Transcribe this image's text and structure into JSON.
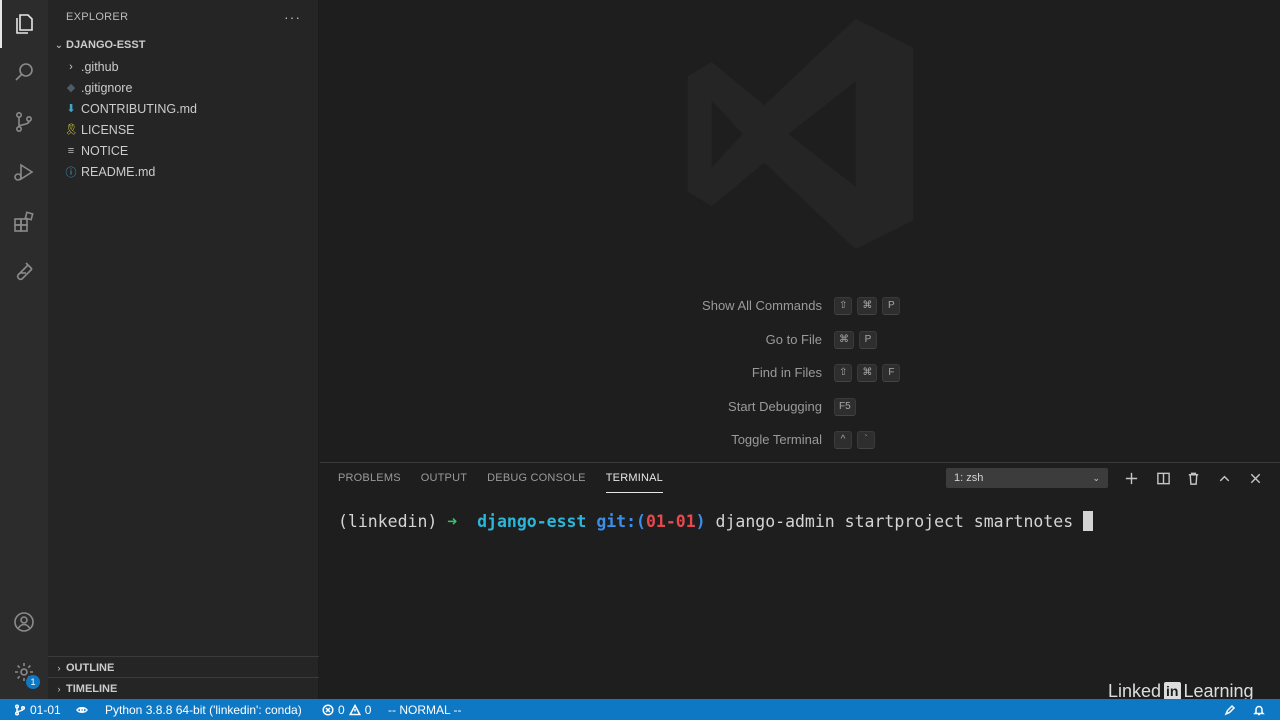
{
  "sidebar": {
    "title": "EXPLORER",
    "more": "···",
    "root": "DJANGO-ESST",
    "items": [
      {
        "label": ".github",
        "icon": "chevron-right-icon",
        "glyph": "›",
        "color": "#cccccc"
      },
      {
        "label": ".gitignore",
        "icon": "git-diamond-icon",
        "glyph": "◆",
        "color": "#4f5b66"
      },
      {
        "label": "CONTRIBUTING.md",
        "icon": "markdown-icon",
        "glyph": "⬇",
        "color": "#42a5c5"
      },
      {
        "label": "LICENSE",
        "icon": "license-icon",
        "glyph": "🎗",
        "color": "#cbcb41"
      },
      {
        "label": "NOTICE",
        "icon": "text-lines-icon",
        "glyph": "≡",
        "color": "#bbbbbb"
      },
      {
        "label": "README.md",
        "icon": "info-icon",
        "glyph": "ⓘ",
        "color": "#42a5c5"
      }
    ],
    "outline": "OUTLINE",
    "timeline": "TIMELINE"
  },
  "activity": {
    "account_badge": "1"
  },
  "welcome": {
    "shortcuts": [
      {
        "label": "Show All Commands",
        "keys": [
          "⇧",
          "⌘",
          "P"
        ]
      },
      {
        "label": "Go to File",
        "keys": [
          "⌘",
          "P"
        ]
      },
      {
        "label": "Find in Files",
        "keys": [
          "⇧",
          "⌘",
          "F"
        ]
      },
      {
        "label": "Start Debugging",
        "keys": [
          "F5"
        ]
      },
      {
        "label": "Toggle Terminal",
        "keys": [
          "^",
          "`"
        ]
      }
    ]
  },
  "panel": {
    "tabs": [
      "PROBLEMS",
      "OUTPUT",
      "DEBUG CONSOLE",
      "TERMINAL"
    ],
    "active_tab": "TERMINAL",
    "terminal_select": "1: zsh",
    "terminal": {
      "env": "(linkedin) ",
      "arrow": "➜",
      "dir": "django-esst",
      "git_prefix": "git:(",
      "branch": "01-01",
      "git_suffix": ")",
      "command": " django-admin startproject smartnotes "
    }
  },
  "statusbar": {
    "branch": "01-01",
    "interpreter": "Python 3.8.8 64-bit ('linkedin': conda)",
    "errors": "0",
    "warnings": "0",
    "mode": "-- NORMAL --"
  },
  "watermark": {
    "brand_left": "Linked",
    "brand_in": "in",
    "brand_right": " Learning"
  },
  "colors": {
    "statusbar": "#0e78c4",
    "activitybar": "#2c2c2c",
    "sidebar": "#252526",
    "editor": "#1e1e1e"
  }
}
